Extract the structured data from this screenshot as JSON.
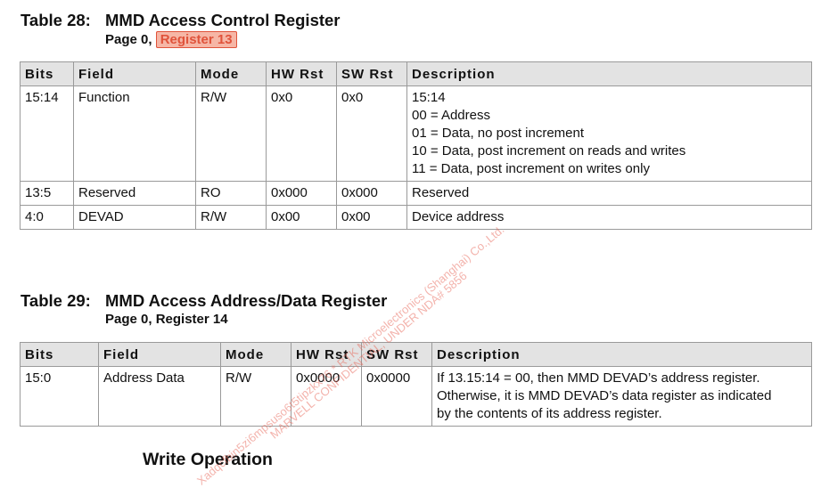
{
  "table28": {
    "number": "Table 28:",
    "title": "MMD Access Control Register",
    "subtitle_prefix": "Page 0, ",
    "subtitle_highlight": "Register 13",
    "headers": [
      "Bits",
      "Field",
      "Mode",
      "HW Rst",
      "SW Rst",
      "Description"
    ],
    "rows": [
      {
        "bits": "15:14",
        "field": "Function",
        "mode": "R/W",
        "hw": "0x0",
        "sw": "0x0",
        "desc": [
          "15:14",
          "00 = Address",
          "01 = Data, no post increment",
          "10 = Data, post increment on reads and writes",
          "11 = Data, post increment on writes only"
        ]
      },
      {
        "bits": "13:5",
        "field": "Reserved",
        "mode": "RO",
        "hw": "0x000",
        "sw": "0x000",
        "desc": [
          "Reserved"
        ]
      },
      {
        "bits": "4:0",
        "field": "DEVAD",
        "mode": "R/W",
        "hw": "0x00",
        "sw": "0x00",
        "desc": [
          "Device address"
        ]
      }
    ]
  },
  "table29": {
    "number": "Table 29:",
    "title": "MMD Access Address/Data Register",
    "subtitle": "Page 0, Register 14",
    "headers": [
      "Bits",
      "Field",
      "Mode",
      "HW Rst",
      "SW Rst",
      "Description"
    ],
    "rows": [
      {
        "bits": "15:0",
        "field": "Address Data",
        "mode": "R/W",
        "hw": "0x0000",
        "sw": "0x0000",
        "desc": [
          "If 13.15:14 = 00, then MMD DEVAD’s address register.",
          "Otherwise, it is MMD DEVAD’s data register as indicated",
          "by the contents of its address register."
        ]
      }
    ]
  },
  "section_heading": "Write Operation",
  "watermark": {
    "line1": "Xadqcfbin5zi6mpsuso6t5tipzkx76 * RTK Microelectronics (Shanghai) Co.,Ltd.",
    "line2": "MARVELL CONFIDENTIAL, UNDER NDA# 5856"
  }
}
